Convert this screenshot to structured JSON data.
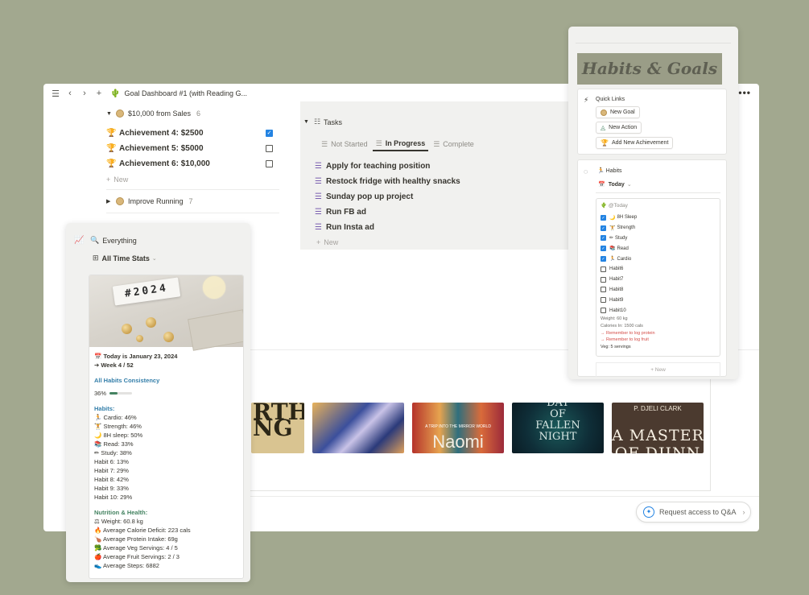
{
  "topbar": {
    "title": "Goal Dashboard #1 (with Reading G...",
    "page_icon": "cactus-icon",
    "more": "•••"
  },
  "goals": {
    "group1": {
      "label": "$10,000 from Sales",
      "count": "6"
    },
    "achievements": [
      {
        "label": "Achievement 4: $2500",
        "checked": true
      },
      {
        "label": "Achievement 5: $5000",
        "checked": false
      },
      {
        "label": "Achievement 6: $10,000",
        "checked": false
      }
    ],
    "new_label": "New",
    "group2": {
      "label": "Improve Running",
      "count": "7"
    }
  },
  "tasks": {
    "title": "Tasks",
    "tabs": [
      "Not Started",
      "In Progress",
      "Complete"
    ],
    "active_tab": "In Progress",
    "items": [
      "Apply for teaching position",
      "Restock fridge with healthy snacks",
      "Sunday pop up project",
      "Run FB ad",
      "Run Insta ad"
    ],
    "new_label": "New"
  },
  "books": {
    "cover1_text": "RTH\nNG",
    "cover3_sub": "A TRIP INTO THE MIRROR WORLD",
    "cover3_title": "Naomi",
    "cover4_title": "DAY\nOF\nFALLEN\nNIGHT",
    "cover5_author": "P. DJELI CLARK",
    "cover5_title": "A MASTER\nOF DJINN"
  },
  "request_button": {
    "label": "Request access to Q&A"
  },
  "stats": {
    "view": "Everything",
    "subview": "All Time Stats",
    "image_board_text": "#2024",
    "date_line": "Today is January 23, 2024",
    "week_line": "➔ Week 4 / 52",
    "consistency_title": "All Habits Consistency",
    "consistency_value": "36%",
    "consistency_fraction": 0.36,
    "habits_title": "Habits:",
    "habits": [
      "Cardio: 46%",
      "Strength: 46%",
      "8H sleep: 50%",
      "Read: 33%",
      "Study: 38%",
      "Habit 6: 13%",
      "Habit 7: 29%",
      "Habit 8: 42%",
      "Habit 9: 33%",
      "Habit 10: 29%"
    ],
    "habit_icons": [
      "🏃",
      "🏋",
      "🌙",
      "📚",
      "✏",
      "",
      "",
      "",
      "",
      ""
    ],
    "nutrition_title": "Nutrition & Health:",
    "nutrition": [
      "Weight: 60.8 kg",
      "Average Calorie Deficit: 223 cals",
      "Average Protein Intake: 69g",
      "Average Veg Servings: 4 / 5",
      "Average Fruit Servings: 2 / 3",
      "Average Steps: 6882"
    ],
    "nutrition_icons": [
      "⚖",
      "🔥",
      "🍗",
      "🥦",
      "🍎",
      "👟"
    ]
  },
  "right": {
    "banner": "Habits & Goals",
    "quick_links_title": "Quick Links",
    "quick_links": [
      "New Goal",
      "New Action",
      "Add New Achievement"
    ],
    "habits_title": "Habits",
    "filter": "Today",
    "card_title": "@Today",
    "habit_rows": [
      {
        "label": "8H Sleep",
        "checked": true,
        "icon": "🌙"
      },
      {
        "label": "Strength",
        "checked": true,
        "icon": "🏋"
      },
      {
        "label": "Study",
        "checked": true,
        "icon": "✏"
      },
      {
        "label": "Read",
        "checked": true,
        "icon": "📚"
      },
      {
        "label": "Cardio",
        "checked": true,
        "icon": "🏃"
      },
      {
        "label": "Habit6",
        "checked": false,
        "icon": ""
      },
      {
        "label": "Habit7",
        "checked": false,
        "icon": ""
      },
      {
        "label": "Habit8",
        "checked": false,
        "icon": ""
      },
      {
        "label": "Habit9",
        "checked": false,
        "icon": ""
      },
      {
        "label": "Habit10",
        "checked": false,
        "icon": ""
      }
    ],
    "info": [
      {
        "text": "Weight: 60 kg",
        "style": "grey"
      },
      {
        "text": "Calories In: 1500 cals",
        "style": "grey"
      },
      {
        "text": "→ Remember to log protein",
        "style": "red"
      },
      {
        "text": "→ Remember to log fruit",
        "style": "red"
      },
      {
        "text": "Veg: 5 servings",
        "style": "dk"
      }
    ],
    "new_label": "+ New"
  }
}
